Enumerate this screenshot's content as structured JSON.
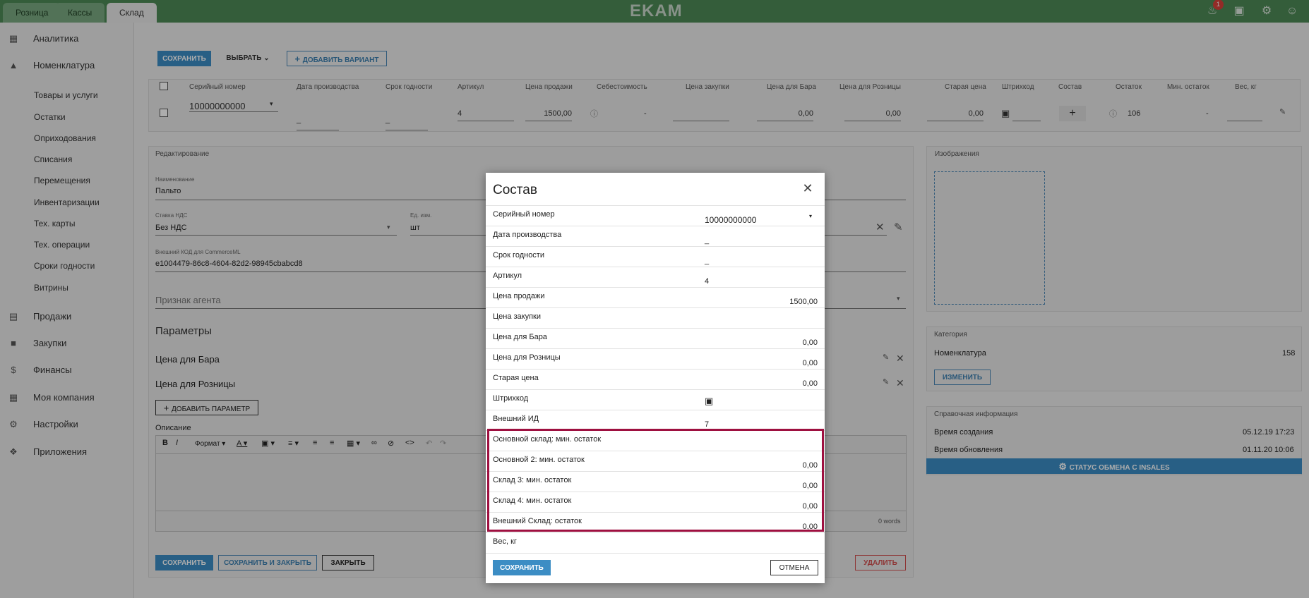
{
  "top_tabs": [
    "Розница",
    "Кассы",
    "Склад"
  ],
  "logo": "EKAM",
  "notification_count": "1",
  "sidebar": {
    "items": [
      {
        "label": "Аналитика",
        "icon": "bar-chart-icon"
      },
      {
        "label": "Номенклатура",
        "icon": "cart-icon"
      },
      {
        "label": "Продажи",
        "icon": "register-icon"
      },
      {
        "label": "Закупки",
        "icon": "truck-icon"
      },
      {
        "label": "Финансы",
        "icon": "dollar-icon"
      },
      {
        "label": "Моя компания",
        "icon": "building-icon"
      },
      {
        "label": "Настройки",
        "icon": "gear-icon"
      },
      {
        "label": "Приложения",
        "icon": "puzzle-icon"
      }
    ],
    "subitems": [
      "Товары и услуги",
      "Остатки",
      "Оприходования",
      "Списания",
      "Перемещения",
      "Инвентаризации",
      "Тех. карты",
      "Тех. операции",
      "Сроки годности",
      "Витрины"
    ]
  },
  "toolbar": {
    "save": "СОХРАНИТЬ",
    "select": "ВЫБРАТЬ",
    "add_variant": "ДОБАВИТЬ ВАРИАНТ"
  },
  "table": {
    "headers": [
      "Серийный номер",
      "Дата производства",
      "Срок годности",
      "Артикул",
      "Цена продажи",
      "Себестоимость",
      "Цена закупки",
      "Цена для Бара",
      "Цена для Розницы",
      "Старая цена",
      "Штрихкод",
      "Состав",
      "Остаток",
      "Мин. остаток",
      "Вес, кг"
    ],
    "row": {
      "serial": "10000000000",
      "prod_date": "_",
      "expiry": "_",
      "article": "4",
      "price": "1500,00",
      "cost": "-",
      "bar_price": "0,00",
      "retail_price": "0,00",
      "old_price": "0,00",
      "stock": "106",
      "min_stock": "-"
    }
  },
  "edit": {
    "title": "Редактирование",
    "name_label": "Наименование",
    "name_value": "Пальто",
    "vat_label": "Ставка НДС",
    "vat_value": "Без НДС",
    "unit_label": "Ед. изм.",
    "unit_value": "шт",
    "ext_code_label": "Внешний КОД для CommerceML",
    "ext_code_value": "e1004479-86c8-4604-82d2-98945cbabcd8",
    "agent_placeholder": "Признак агента",
    "params_title": "Параметры",
    "params": [
      "Цена для Бара",
      "Цена для Розницы"
    ],
    "add_param": "ДОБАВИТЬ ПАРАМЕТР",
    "description_label": "Описание",
    "format_label": "Формат",
    "word_count": "0 words",
    "save": "СОХРАНИТЬ",
    "save_close": "СОХРАНИТЬ И ЗАКРЫТЬ",
    "close": "ЗАКРЫТЬ",
    "delete": "УДАЛИТЬ"
  },
  "right": {
    "images_title": "Изображения",
    "category_title": "Категория",
    "category_name": "Номенклатура",
    "category_count": "158",
    "change": "ИЗМЕНИТЬ",
    "info_title": "Справочная информация",
    "created_label": "Время создания",
    "created_value": "05.12.19 17:23",
    "updated_label": "Время обновления",
    "updated_value": "01.11.20 10:06",
    "insales": "СТАТУС ОБМЕНА С INSALES"
  },
  "modal": {
    "title": "Состав",
    "rows": [
      {
        "label": "Серийный номер",
        "value": "10000000000"
      },
      {
        "label": "Дата производства",
        "value": "_"
      },
      {
        "label": "Срок годности",
        "value": "_"
      },
      {
        "label": "Артикул",
        "value": "4"
      },
      {
        "label": "Цена продажи",
        "value": "1500,00"
      },
      {
        "label": "Цена закупки",
        "value": ""
      },
      {
        "label": "Цена для Бара",
        "value": "0,00"
      },
      {
        "label": "Цена для Розницы",
        "value": "0,00"
      },
      {
        "label": "Старая цена",
        "value": "0,00"
      },
      {
        "label": "Штрихкод",
        "value": ""
      },
      {
        "label": "Внешний ИД",
        "value": "7"
      },
      {
        "label": "Основной склад: мин. остаток",
        "value": ""
      },
      {
        "label": "Основной 2: мин. остаток",
        "value": "0,00"
      },
      {
        "label": "Склад 3: мин. остаток",
        "value": "0,00"
      },
      {
        "label": "Склад 4: мин. остаток",
        "value": "0,00"
      },
      {
        "label": "Внешний Склад: остаток",
        "value": "0,00"
      },
      {
        "label": "Вес, кг",
        "value": ""
      }
    ],
    "save": "СОХРАНИТЬ",
    "cancel": "ОТМЕНА"
  }
}
